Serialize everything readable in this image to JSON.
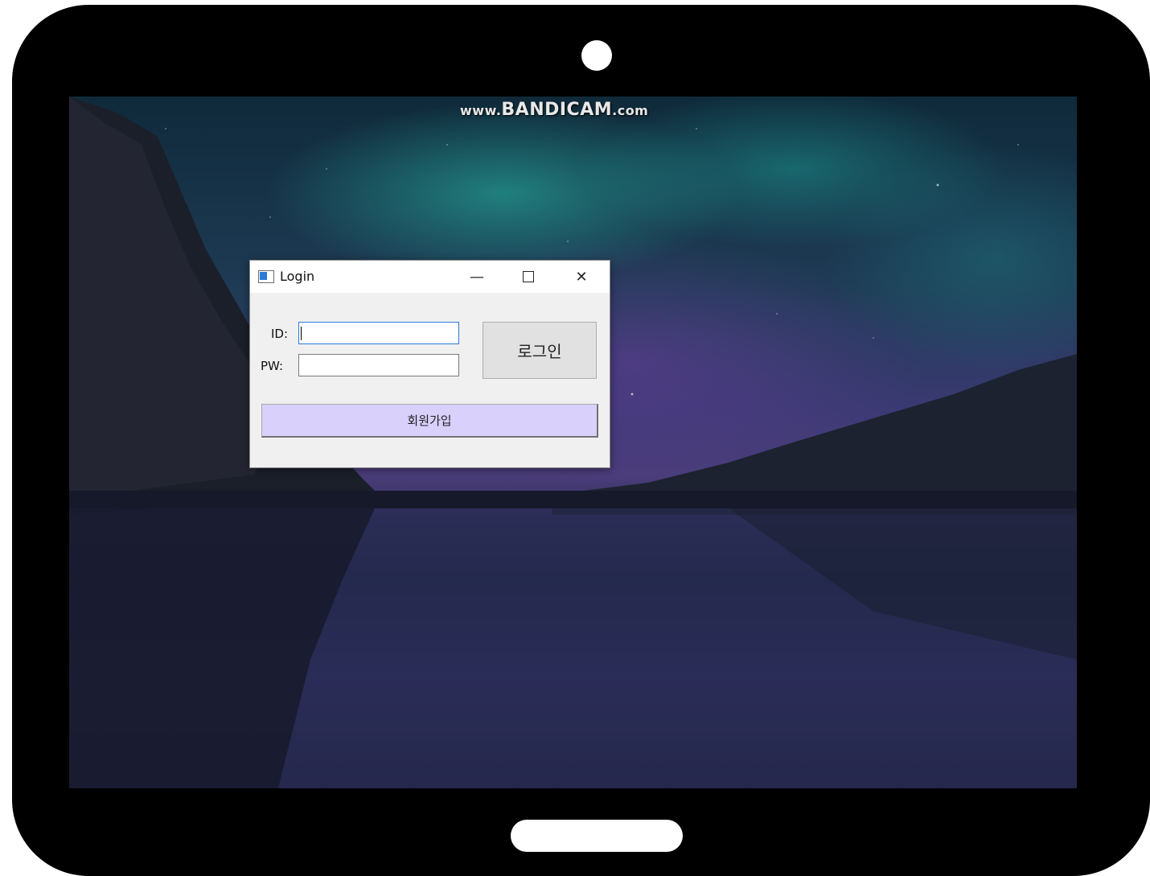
{
  "watermark": {
    "prefix": "www.",
    "brand": "BANDICAM",
    "suffix": ".com"
  },
  "window": {
    "title": "Login",
    "controls": {
      "minimize": "—",
      "close": "✕"
    }
  },
  "form": {
    "id_label": "ID:",
    "id_value": "",
    "pw_label": "PW:",
    "pw_value": "",
    "login_label": "로그인",
    "signup_label": "회원가입"
  },
  "colors": {
    "signup_button": "#d9d0fb",
    "focus_border": "#2b7bd8",
    "device_frame": "#000000"
  }
}
